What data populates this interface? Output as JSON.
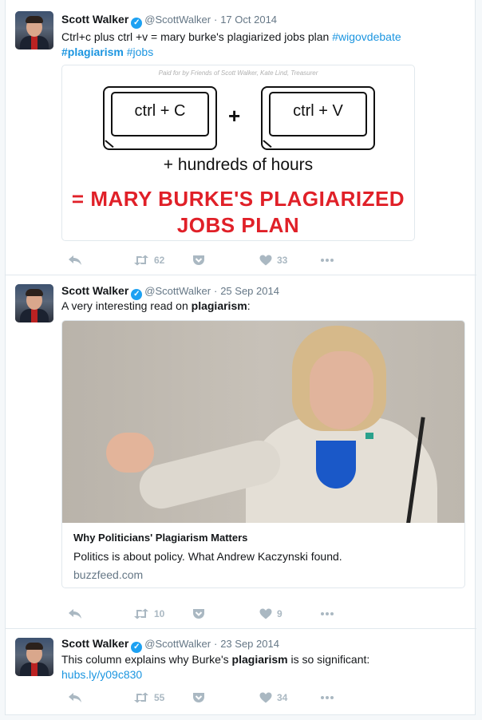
{
  "tweets": [
    {
      "name": "Scott Walker",
      "handle": "@ScottWalker",
      "sep": "·",
      "date": "17 Oct 2014",
      "text_plain": "Ctrl+c plus ctrl +v = mary burke's plagiarized jobs plan ",
      "hashtag1": "#wigovdebate",
      "hashtag2": "#plagiarism",
      "hashtag3": "#jobs",
      "ad": {
        "paid_for": "Paid for by Friends of Scott Walker, Kate Lind, Treasurer",
        "key1": "ctrl + C",
        "plus": "+",
        "key2": "ctrl + V",
        "hours": "+ hundreds of hours",
        "headline_line1": "= MARY BURKE'S PLAGIARIZED",
        "headline_line2": "JOBS PLAN"
      },
      "retweets": "62",
      "likes": "33"
    },
    {
      "name": "Scott Walker",
      "handle": "@ScottWalker",
      "sep": "·",
      "date": "25 Sep 2014",
      "text_plain": "A very interesting read on ",
      "text_bold": "plagiarism",
      "text_end": ":",
      "card": {
        "title": "Why Politicians' Plagiarism Matters",
        "description": "Politics is about policy. What Andrew Kaczynski found.",
        "domain": "buzzfeed.com"
      },
      "retweets": "10",
      "likes": "9"
    },
    {
      "name": "Scott Walker",
      "handle": "@ScottWalker",
      "sep": "·",
      "date": "23 Sep 2014",
      "text_plain": "This column explains why Burke's ",
      "text_bold": "plagiarism",
      "text_end": " is so significant:",
      "link": "hubs.ly/y09c830",
      "retweets": "55",
      "likes": "34"
    }
  ],
  "colors": {
    "link": "#1b95e0",
    "accent_red": "#e02028",
    "verified": "#1da1f2",
    "icon_gray": "#aab8c2"
  },
  "icons": [
    "reply-icon",
    "retweet-icon",
    "pocket-icon",
    "heart-icon",
    "more-icon",
    "verified-icon"
  ]
}
